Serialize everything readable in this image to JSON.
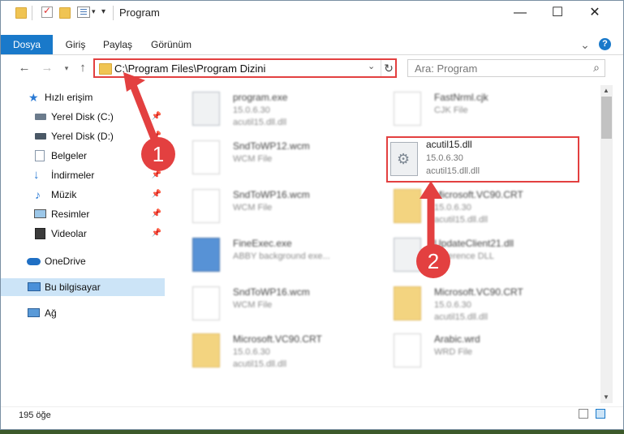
{
  "window": {
    "title": "Program",
    "controls": {
      "minimize": "—",
      "maximize": "☐",
      "close": "✕"
    }
  },
  "ribbon": {
    "tabs": [
      "Dosya",
      "Giriş",
      "Paylaş",
      "Görünüm"
    ],
    "expand_glyph": "⌄",
    "help_glyph": "?"
  },
  "address": {
    "path": "C:\\Program Files\\Program Dizini",
    "search_placeholder": "Ara: Program"
  },
  "sidebar": {
    "items": [
      {
        "label": "Hızlı erişim",
        "icon": "star-icon",
        "pinned": false
      },
      {
        "label": "Yerel Disk (C:)",
        "icon": "drive-icon",
        "pinned": true
      },
      {
        "label": "Yerel Disk (D:)",
        "icon": "drive-icon",
        "pinned": true
      },
      {
        "label": "Belgeler",
        "icon": "documents-icon",
        "pinned": true
      },
      {
        "label": "İndirmeler",
        "icon": "download-icon",
        "pinned": true
      },
      {
        "label": "Müzik",
        "icon": "music-icon",
        "pinned": true
      },
      {
        "label": "Resimler",
        "icon": "pictures-icon",
        "pinned": true
      },
      {
        "label": "Videolar",
        "icon": "videos-icon",
        "pinned": true
      },
      {
        "label": "OneDrive",
        "icon": "cloud-icon",
        "pinned": false
      },
      {
        "label": "Bu bilgisayar",
        "icon": "computer-icon",
        "pinned": false
      },
      {
        "label": "Ağ",
        "icon": "network-icon",
        "pinned": false
      }
    ]
  },
  "files": {
    "left": [
      {
        "name": "program.exe",
        "line2": "15.0.6.30",
        "line3": "acutil15.dll.dll"
      },
      {
        "name": "SndToWP12.wcm",
        "line2": "WCM File",
        "line3": ""
      },
      {
        "name": "SndToWP16.wcm",
        "line2": "WCM File",
        "line3": ""
      },
      {
        "name": "FineExec.exe",
        "line2": "ABBY background exe...",
        "line3": ""
      },
      {
        "name": "SndToWP16.wcm",
        "line2": "WCM File",
        "line3": ""
      },
      {
        "name": "Microsoft.VC90.CRT",
        "line2": "15.0.6.30",
        "line3": "acutil15.dll.dll"
      }
    ],
    "right": [
      {
        "name": "FastNrml.cjk",
        "line2": "CJK File",
        "line3": ""
      },
      {
        "name": "acutil15.dll",
        "line2": "15.0.6.30",
        "line3": "acutil15.dll.dll"
      },
      {
        "name": "Microsoft.VC90.CRT",
        "line2": "15.0.6.30",
        "line3": "acutil15.dll.dll"
      },
      {
        "name": "UpdateClient21.dll",
        "line2": "Reference DLL",
        "line3": ""
      },
      {
        "name": "Microsoft.VC90.CRT",
        "line2": "15.0.6.30",
        "line3": "acutil15.dll.dll"
      },
      {
        "name": "Arabic.wrd",
        "line2": "WRD File",
        "line3": ""
      }
    ]
  },
  "status": {
    "item_count": "195 öğe"
  },
  "annotations": {
    "step1": "1",
    "step2": "2",
    "color": "#e34040"
  }
}
